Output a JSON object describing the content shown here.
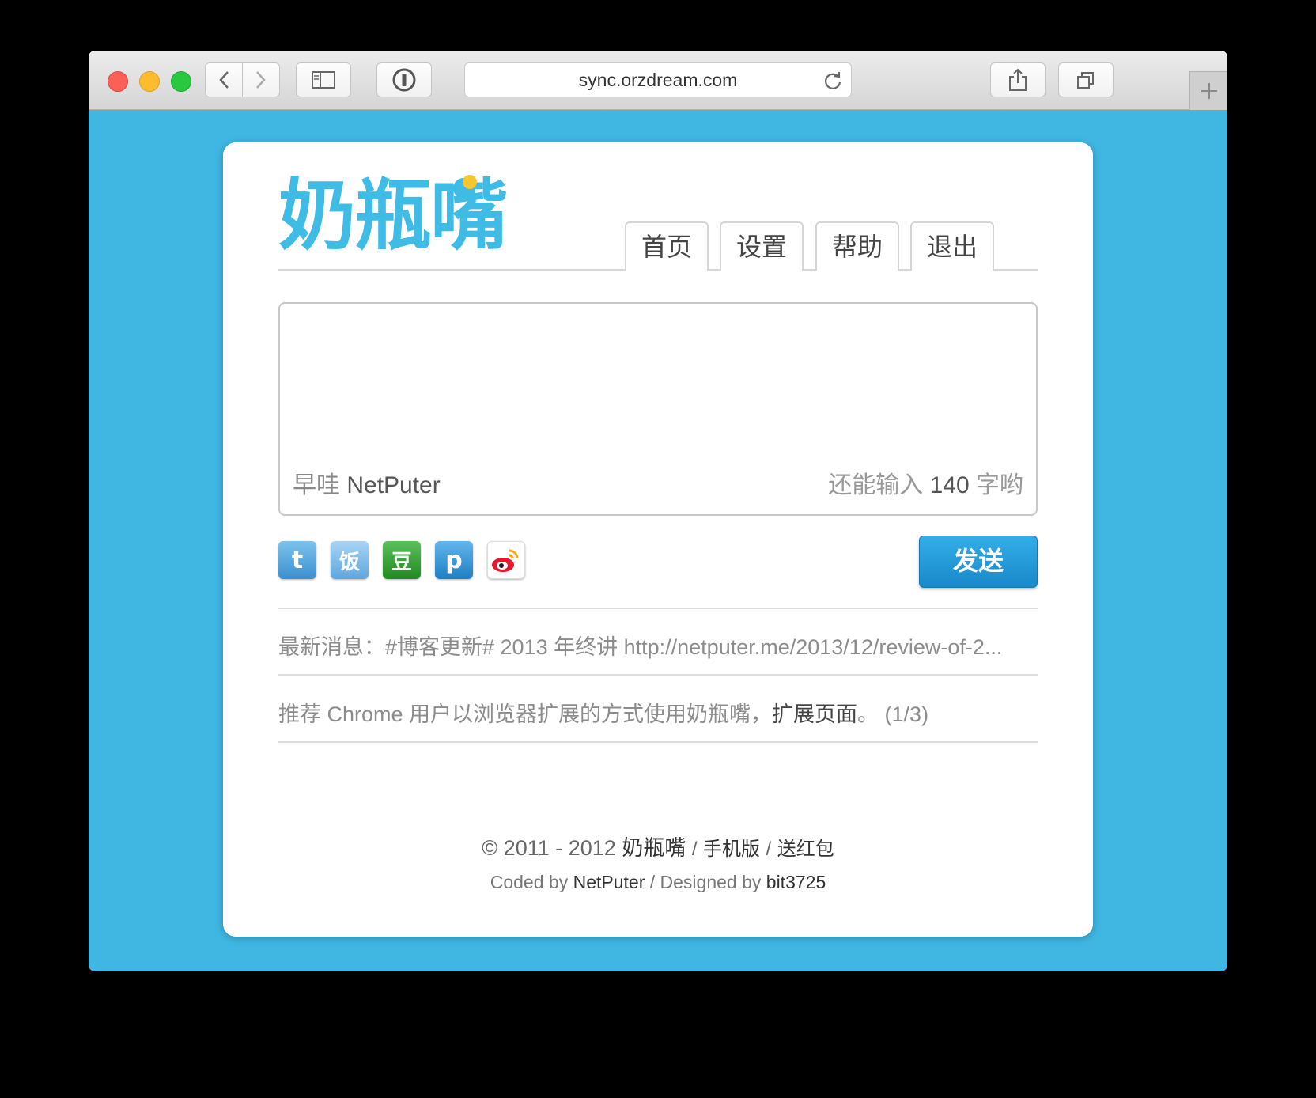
{
  "browser": {
    "url": "sync.orzdream.com"
  },
  "logo": {
    "text": "奶瓶嘴"
  },
  "nav": {
    "items": [
      "首页",
      "设置",
      "帮助",
      "退出"
    ]
  },
  "compose": {
    "greeting": "早哇",
    "username": "NetPuter",
    "counter_prefix": "还能输入",
    "counter_value": "140",
    "counter_suffix": "字哟",
    "send_label": "发送"
  },
  "services": [
    {
      "name": "twitter",
      "glyph": "t",
      "color": "#4aa0d8"
    },
    {
      "name": "fanfou",
      "glyph": "饭",
      "color": "#6fb0e2"
    },
    {
      "name": "douban",
      "glyph": "豆",
      "color": "#2f9a2f"
    },
    {
      "name": "plurk",
      "glyph": "p",
      "color": "#2a8fd1"
    },
    {
      "name": "weibo",
      "glyph": "",
      "color": "#ffffff"
    }
  ],
  "news": {
    "label": "最新消息：",
    "text": "#博客更新# 2013 年终讲 http://netputer.me/2013/12/review-of-2..."
  },
  "tip": {
    "text": "推荐 Chrome 用户以浏览器扩展的方式使用奶瓶嘴，",
    "link": "扩展页面",
    "suffix": "。 (1/3)"
  },
  "footer": {
    "copyright": "© 2011 - 2012",
    "brand": "奶瓶嘴",
    "sep": "/",
    "mobile": "手机版",
    "gift": "送红包",
    "coded_by": "Coded by",
    "coder": "NetPuter",
    "designed_by": "/ Designed by",
    "designer": "bit3725"
  },
  "colors": {
    "page_bg": "#3fb7e2",
    "accent": "#3fbce6",
    "send_button": "#1f95d4"
  }
}
